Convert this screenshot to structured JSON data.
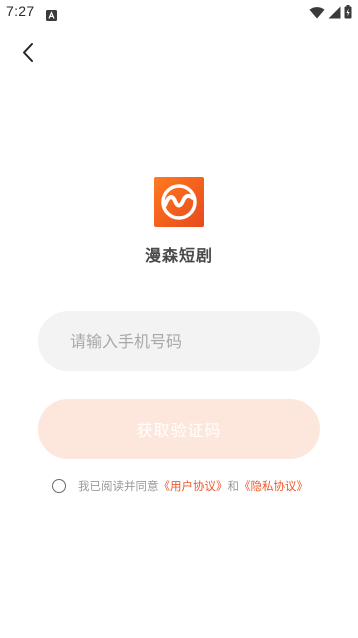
{
  "status_bar": {
    "time": "7:27",
    "icons": [
      "a-icon",
      "wifi-icon",
      "signal-icon",
      "battery-icon"
    ]
  },
  "nav": {
    "back_icon": "back-arrow-icon"
  },
  "app": {
    "name": "漫森短剧",
    "logo_icon": "app-logo-icon",
    "brand_color": "#f26522"
  },
  "login": {
    "phone_placeholder": "请输入手机号码",
    "phone_value": "",
    "get_code_label": "获取验证码",
    "button_color": "#fde7dc"
  },
  "agreement": {
    "prefix": "我已阅读并同意",
    "user_agreement": "《用户协议》",
    "conjunction": "和",
    "privacy_policy": "《隐私协议》",
    "checked": false,
    "link_color": "#f0582a"
  }
}
